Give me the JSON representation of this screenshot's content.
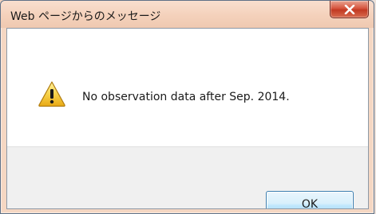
{
  "dialog": {
    "title": "Web ページからのメッセージ",
    "message": "No observation data after Sep. 2014.",
    "ok_label": "OK",
    "close_icon": "close-x-icon",
    "message_icon": "warning-icon"
  },
  "colors": {
    "frame": "#f4d1bb",
    "close_button": "#c9462d",
    "button_area": "#f0f0f0",
    "ok_border": "#3c7fb1"
  }
}
